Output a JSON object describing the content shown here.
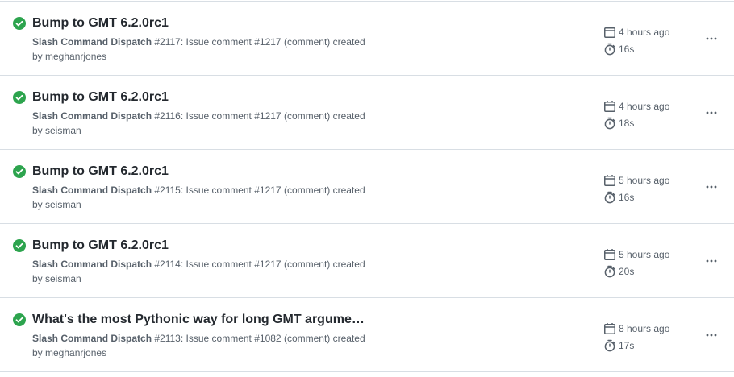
{
  "colors": {
    "success": "#2da44e",
    "text": "#24292f",
    "muted": "#57606a",
    "border": "#d8dee4"
  },
  "icons": {
    "status": "check-circle-fill-icon",
    "date": "calendar-icon",
    "duration": "stopwatch-icon",
    "menu": "kebab-horizontal-icon"
  },
  "runs": [
    {
      "title": "Bump to GMT 6.2.0rc1",
      "workflow": "Slash Command Dispatch",
      "run_number": "#2117",
      "event_text": ": Issue comment ",
      "issue": "#1217",
      "event_suffix": " (comment) created",
      "by": "by meghanrjones",
      "date": "4 hours ago",
      "duration": "16s"
    },
    {
      "title": "Bump to GMT 6.2.0rc1",
      "workflow": "Slash Command Dispatch",
      "run_number": "#2116",
      "event_text": ": Issue comment ",
      "issue": "#1217",
      "event_suffix": " (comment) created",
      "by": "by seisman",
      "date": "4 hours ago",
      "duration": "18s"
    },
    {
      "title": "Bump to GMT 6.2.0rc1",
      "workflow": "Slash Command Dispatch",
      "run_number": "#2115",
      "event_text": ": Issue comment ",
      "issue": "#1217",
      "event_suffix": " (comment) created",
      "by": "by seisman",
      "date": "5 hours ago",
      "duration": "16s"
    },
    {
      "title": "Bump to GMT 6.2.0rc1",
      "workflow": "Slash Command Dispatch",
      "run_number": "#2114",
      "event_text": ": Issue comment ",
      "issue": "#1217",
      "event_suffix": " (comment) created",
      "by": "by seisman",
      "date": "5 hours ago",
      "duration": "20s"
    },
    {
      "title": "What's the most Pythonic way for long GMT argume…",
      "workflow": "Slash Command Dispatch",
      "run_number": "#2113",
      "event_text": ": Issue comment ",
      "issue": "#1082",
      "event_suffix": " (comment) created",
      "by": "by meghanrjones",
      "date": "8 hours ago",
      "duration": "17s"
    }
  ]
}
